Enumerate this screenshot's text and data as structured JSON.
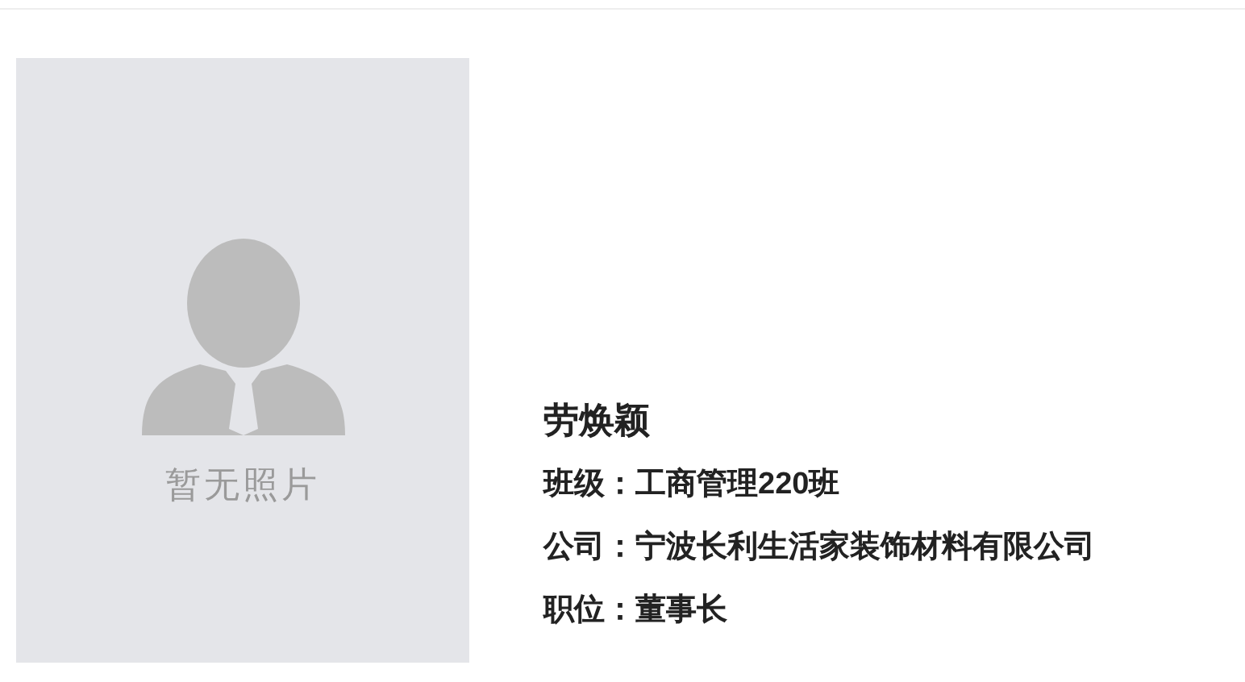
{
  "photo": {
    "placeholder_text": "暂无照片"
  },
  "profile": {
    "name": "劳焕颖",
    "fields": [
      {
        "label": "班级：",
        "value": "工商管理220班"
      },
      {
        "label": "公司：",
        "value": "宁波长利生活家装饰材料有限公司"
      },
      {
        "label": "职位：",
        "value": "董事长"
      }
    ]
  }
}
